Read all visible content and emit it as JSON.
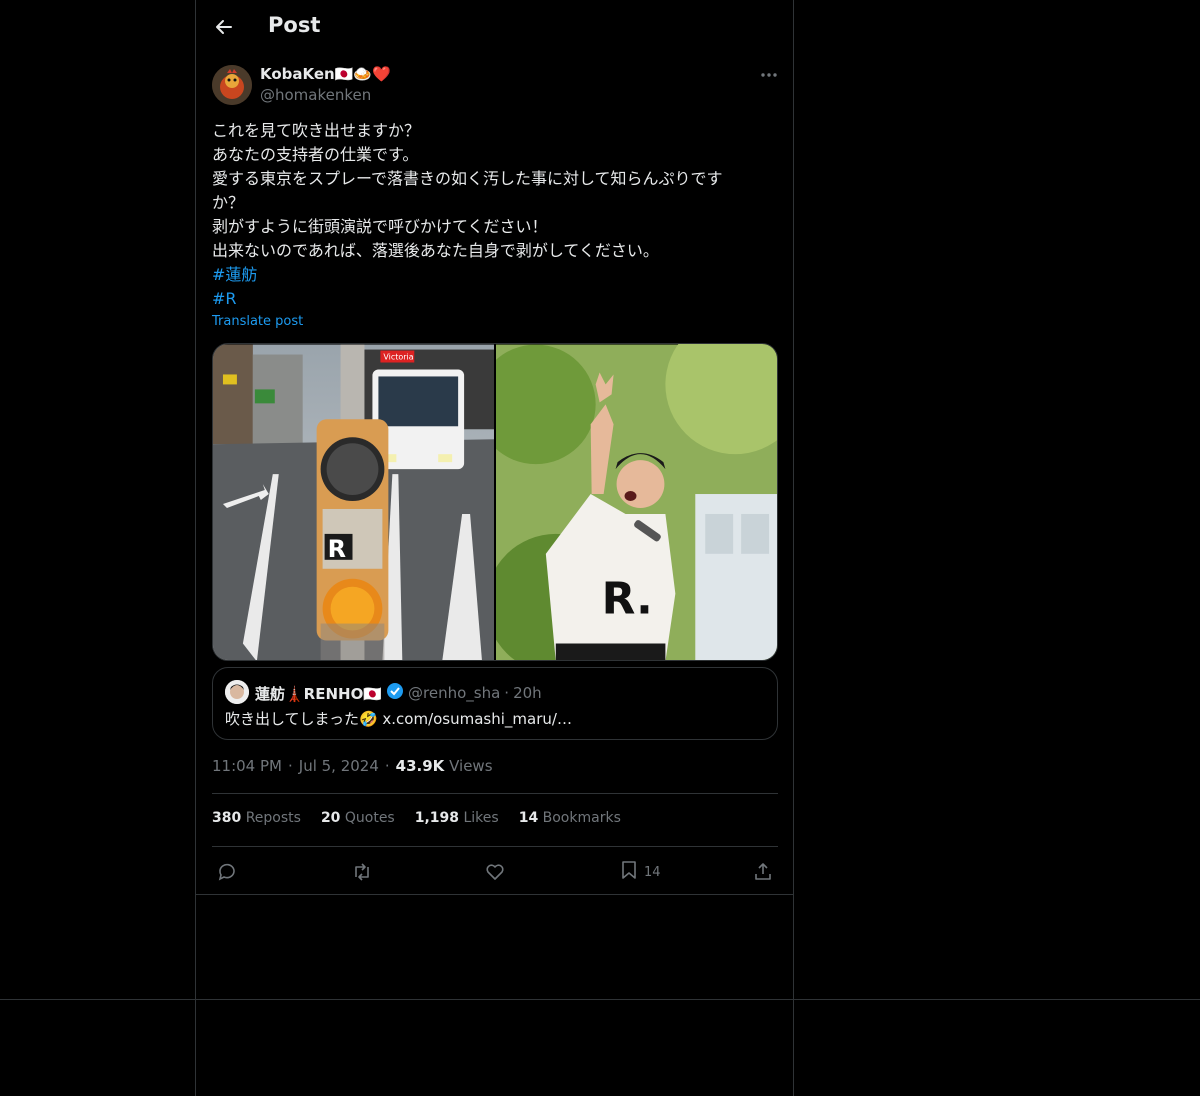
{
  "header": {
    "title": "Post"
  },
  "author": {
    "name": "KobaKen🇯🇵🍛❤️",
    "handle": "@homakenken"
  },
  "post": {
    "lines": [
      "これを見て吹き出せますか？",
      "あなたの支持者の仕業です。",
      "愛する東京をスプレーで落書きの如く汚した事に対して知らんぷりです",
      "か？",
      "剥がすように街頭演説で呼びかけてください！",
      "出来ないのであれば、落選後あなた自身で剥がしてください。"
    ],
    "hashtags": [
      "#蓮舫",
      "#R"
    ],
    "translate": "Translate post"
  },
  "media": {
    "sign_text": "Victoria",
    "logo_letter": "R",
    "shirt_text": "R."
  },
  "quote": {
    "name": "蓮舫🗼RENHO🇯🇵",
    "handle": "@renho_sha",
    "dot": "·",
    "time": "20h",
    "text": "吹き出してしまった🤣 x.com/osumashi_maru/…"
  },
  "meta": {
    "time": "11:04 PM",
    "dot1": "·",
    "date": "Jul 5, 2024",
    "dot2": "·",
    "views_count": "43.9K",
    "views_label": "Views"
  },
  "stats": {
    "reposts_count": "380",
    "reposts_label": "Reposts",
    "quotes_count": "20",
    "quotes_label": "Quotes",
    "likes_count": "1,198",
    "likes_label": "Likes",
    "bookmarks_count": "14",
    "bookmarks_label": "Bookmarks"
  },
  "actions": {
    "bookmark_count": "14"
  },
  "colors": {
    "accent": "#1d9bf0",
    "border": "#2f3336",
    "muted": "#71767b",
    "text": "#e7e9ea"
  }
}
